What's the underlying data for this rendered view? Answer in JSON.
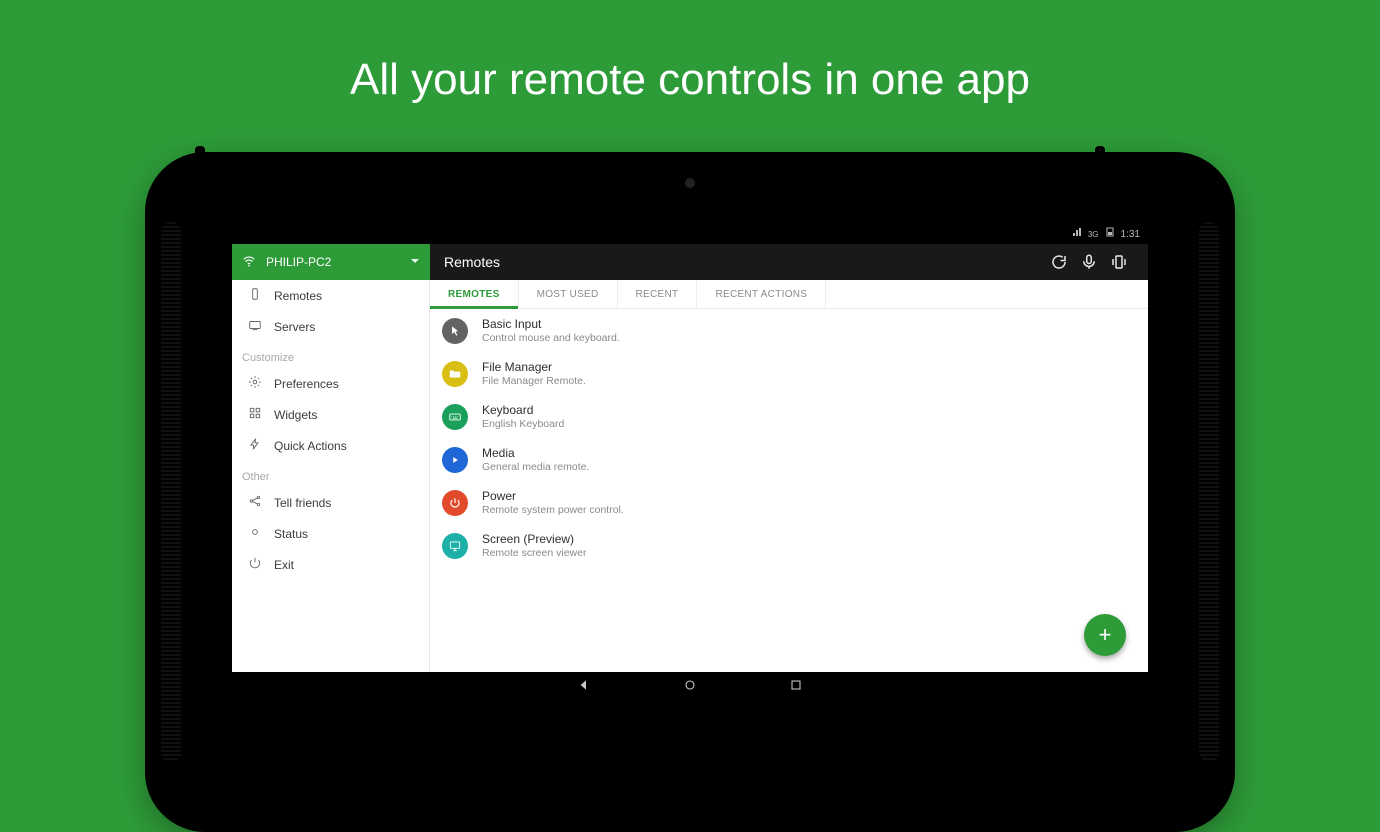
{
  "hero": "All your remote controls in one app",
  "status": {
    "signal_label": "3G",
    "time": "1:31"
  },
  "sidebar": {
    "server": "PHILIP-PC2",
    "nav": [
      {
        "label": "Remotes"
      },
      {
        "label": "Servers"
      }
    ],
    "section_customize": "Customize",
    "customize": [
      {
        "label": "Preferences"
      },
      {
        "label": "Widgets"
      },
      {
        "label": "Quick Actions"
      }
    ],
    "section_other": "Other",
    "other": [
      {
        "label": "Tell friends"
      },
      {
        "label": "Status"
      },
      {
        "label": "Exit"
      }
    ]
  },
  "mainbar": {
    "title": "Remotes"
  },
  "tabs": [
    {
      "label": "REMOTES",
      "active": true
    },
    {
      "label": "MOST USED"
    },
    {
      "label": "RECENT"
    },
    {
      "label": "RECENT ACTIONS"
    }
  ],
  "remotes": [
    {
      "title": "Basic Input",
      "subtitle": "Control mouse and keyboard.",
      "color": "#636363",
      "icon": "cursor"
    },
    {
      "title": "File Manager",
      "subtitle": "File Manager Remote.",
      "color": "#d9bf13",
      "icon": "folder"
    },
    {
      "title": "Keyboard",
      "subtitle": "English Keyboard",
      "color": "#1aa05a",
      "icon": "keyboard"
    },
    {
      "title": "Media",
      "subtitle": "General media remote.",
      "color": "#1f66d6",
      "icon": "media"
    },
    {
      "title": "Power",
      "subtitle": "Remote system power control.",
      "color": "#e24a2c",
      "icon": "power"
    },
    {
      "title": "Screen (Preview)",
      "subtitle": "Remote screen viewer",
      "color": "#1cb0a8",
      "icon": "screen"
    }
  ],
  "fab": "+"
}
